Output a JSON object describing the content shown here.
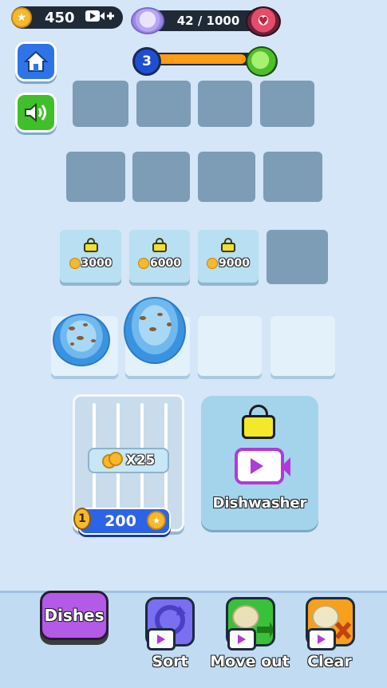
{
  "hud": {
    "coins": "450",
    "plates_progress": "42 / 1000",
    "plates_fraction": 0.042,
    "level": "3",
    "level_progress": 0.9
  },
  "locked_slots": [
    {
      "price": "3000"
    },
    {
      "price": "6000"
    },
    {
      "price": "9000"
    }
  ],
  "rack": {
    "multiplier": "X25",
    "unlock_level": "1",
    "cost": "200"
  },
  "dishwasher": {
    "label": "Dishwasher"
  },
  "bottom": {
    "dishes_label": "Dishes",
    "sort_label": "Sort",
    "move_out_label": "Move out",
    "clear_label": "Clear"
  },
  "colors": {
    "background": "#d4e6f7",
    "accent_blue": "#2d63e6",
    "accent_orange": "#ff9b14",
    "accent_purple": "#b35ae6"
  }
}
